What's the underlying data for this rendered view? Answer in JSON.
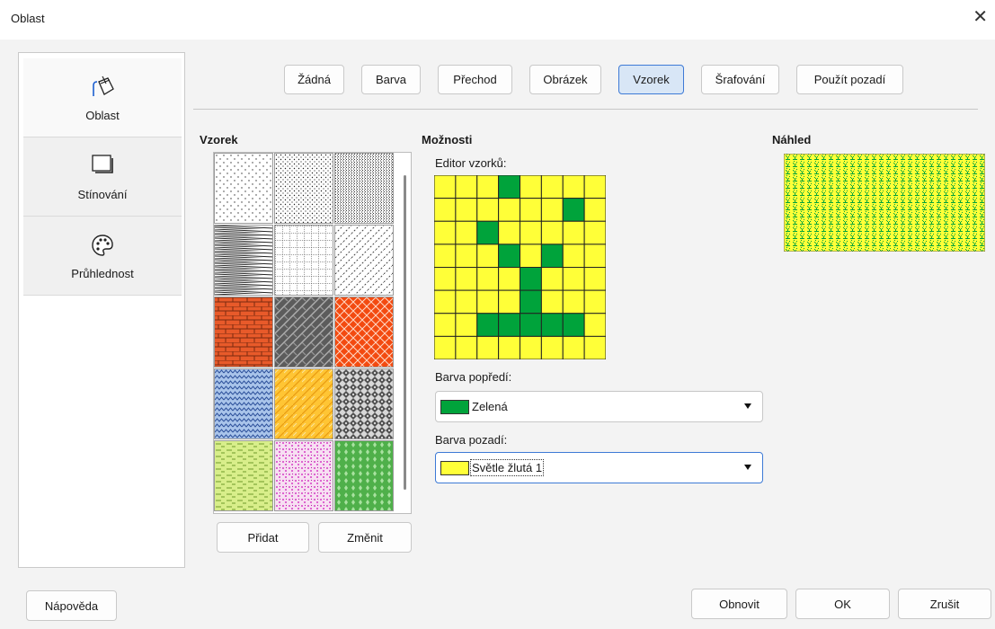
{
  "window": {
    "title": "Oblast",
    "close_glyph": "✕"
  },
  "sidebar": {
    "items": [
      {
        "label": "Oblast",
        "icon": "paint-bucket-icon"
      },
      {
        "label": "Stínování",
        "icon": "shadow-box-icon"
      },
      {
        "label": "Průhlednost",
        "icon": "palette-icon"
      }
    ]
  },
  "tabs": [
    "Žádná",
    "Barva",
    "Přechod",
    "Obrázek",
    "Vzorek",
    "Šrafování",
    "Použít pozadí"
  ],
  "active_tab": "Vzorek",
  "pattern_panel": {
    "heading": "Vzorek",
    "add_label": "Přidat",
    "change_label": "Změnit"
  },
  "options": {
    "heading": "Možnosti",
    "editor_label": "Editor vzorků:",
    "foreground_label": "Barva popředí:",
    "foreground_value": "Zelená",
    "foreground_color": "#00a33b",
    "background_label": "Barva pozadí:",
    "background_value": "Světle žlutá 1",
    "background_color": "#ffff38"
  },
  "pattern_editor": {
    "size": 8,
    "on_cells": [
      [
        0,
        3
      ],
      [
        1,
        6
      ],
      [
        2,
        2
      ],
      [
        3,
        3
      ],
      [
        3,
        5
      ],
      [
        4,
        4
      ],
      [
        5,
        4
      ],
      [
        6,
        2
      ],
      [
        6,
        3
      ],
      [
        6,
        4
      ],
      [
        6,
        5
      ],
      [
        6,
        6
      ]
    ]
  },
  "preview": {
    "heading": "Náhled"
  },
  "footer": {
    "help_label": "Nápověda",
    "reset_label": "Obnovit",
    "ok_label": "OK",
    "cancel_label": "Zrušit"
  },
  "swatches": [
    "dots-sparse-white",
    "dots-medium-white",
    "dots-dense-white",
    "diagonal-lines-dense",
    "grid-small",
    "dashed-diagonal",
    "bricks-orange",
    "weave-gray",
    "tiles-red",
    "zigzag-blue",
    "shingles-yellow",
    "checker-gray",
    "dashes-lime",
    "confetti-magenta",
    "diamonds-green"
  ]
}
